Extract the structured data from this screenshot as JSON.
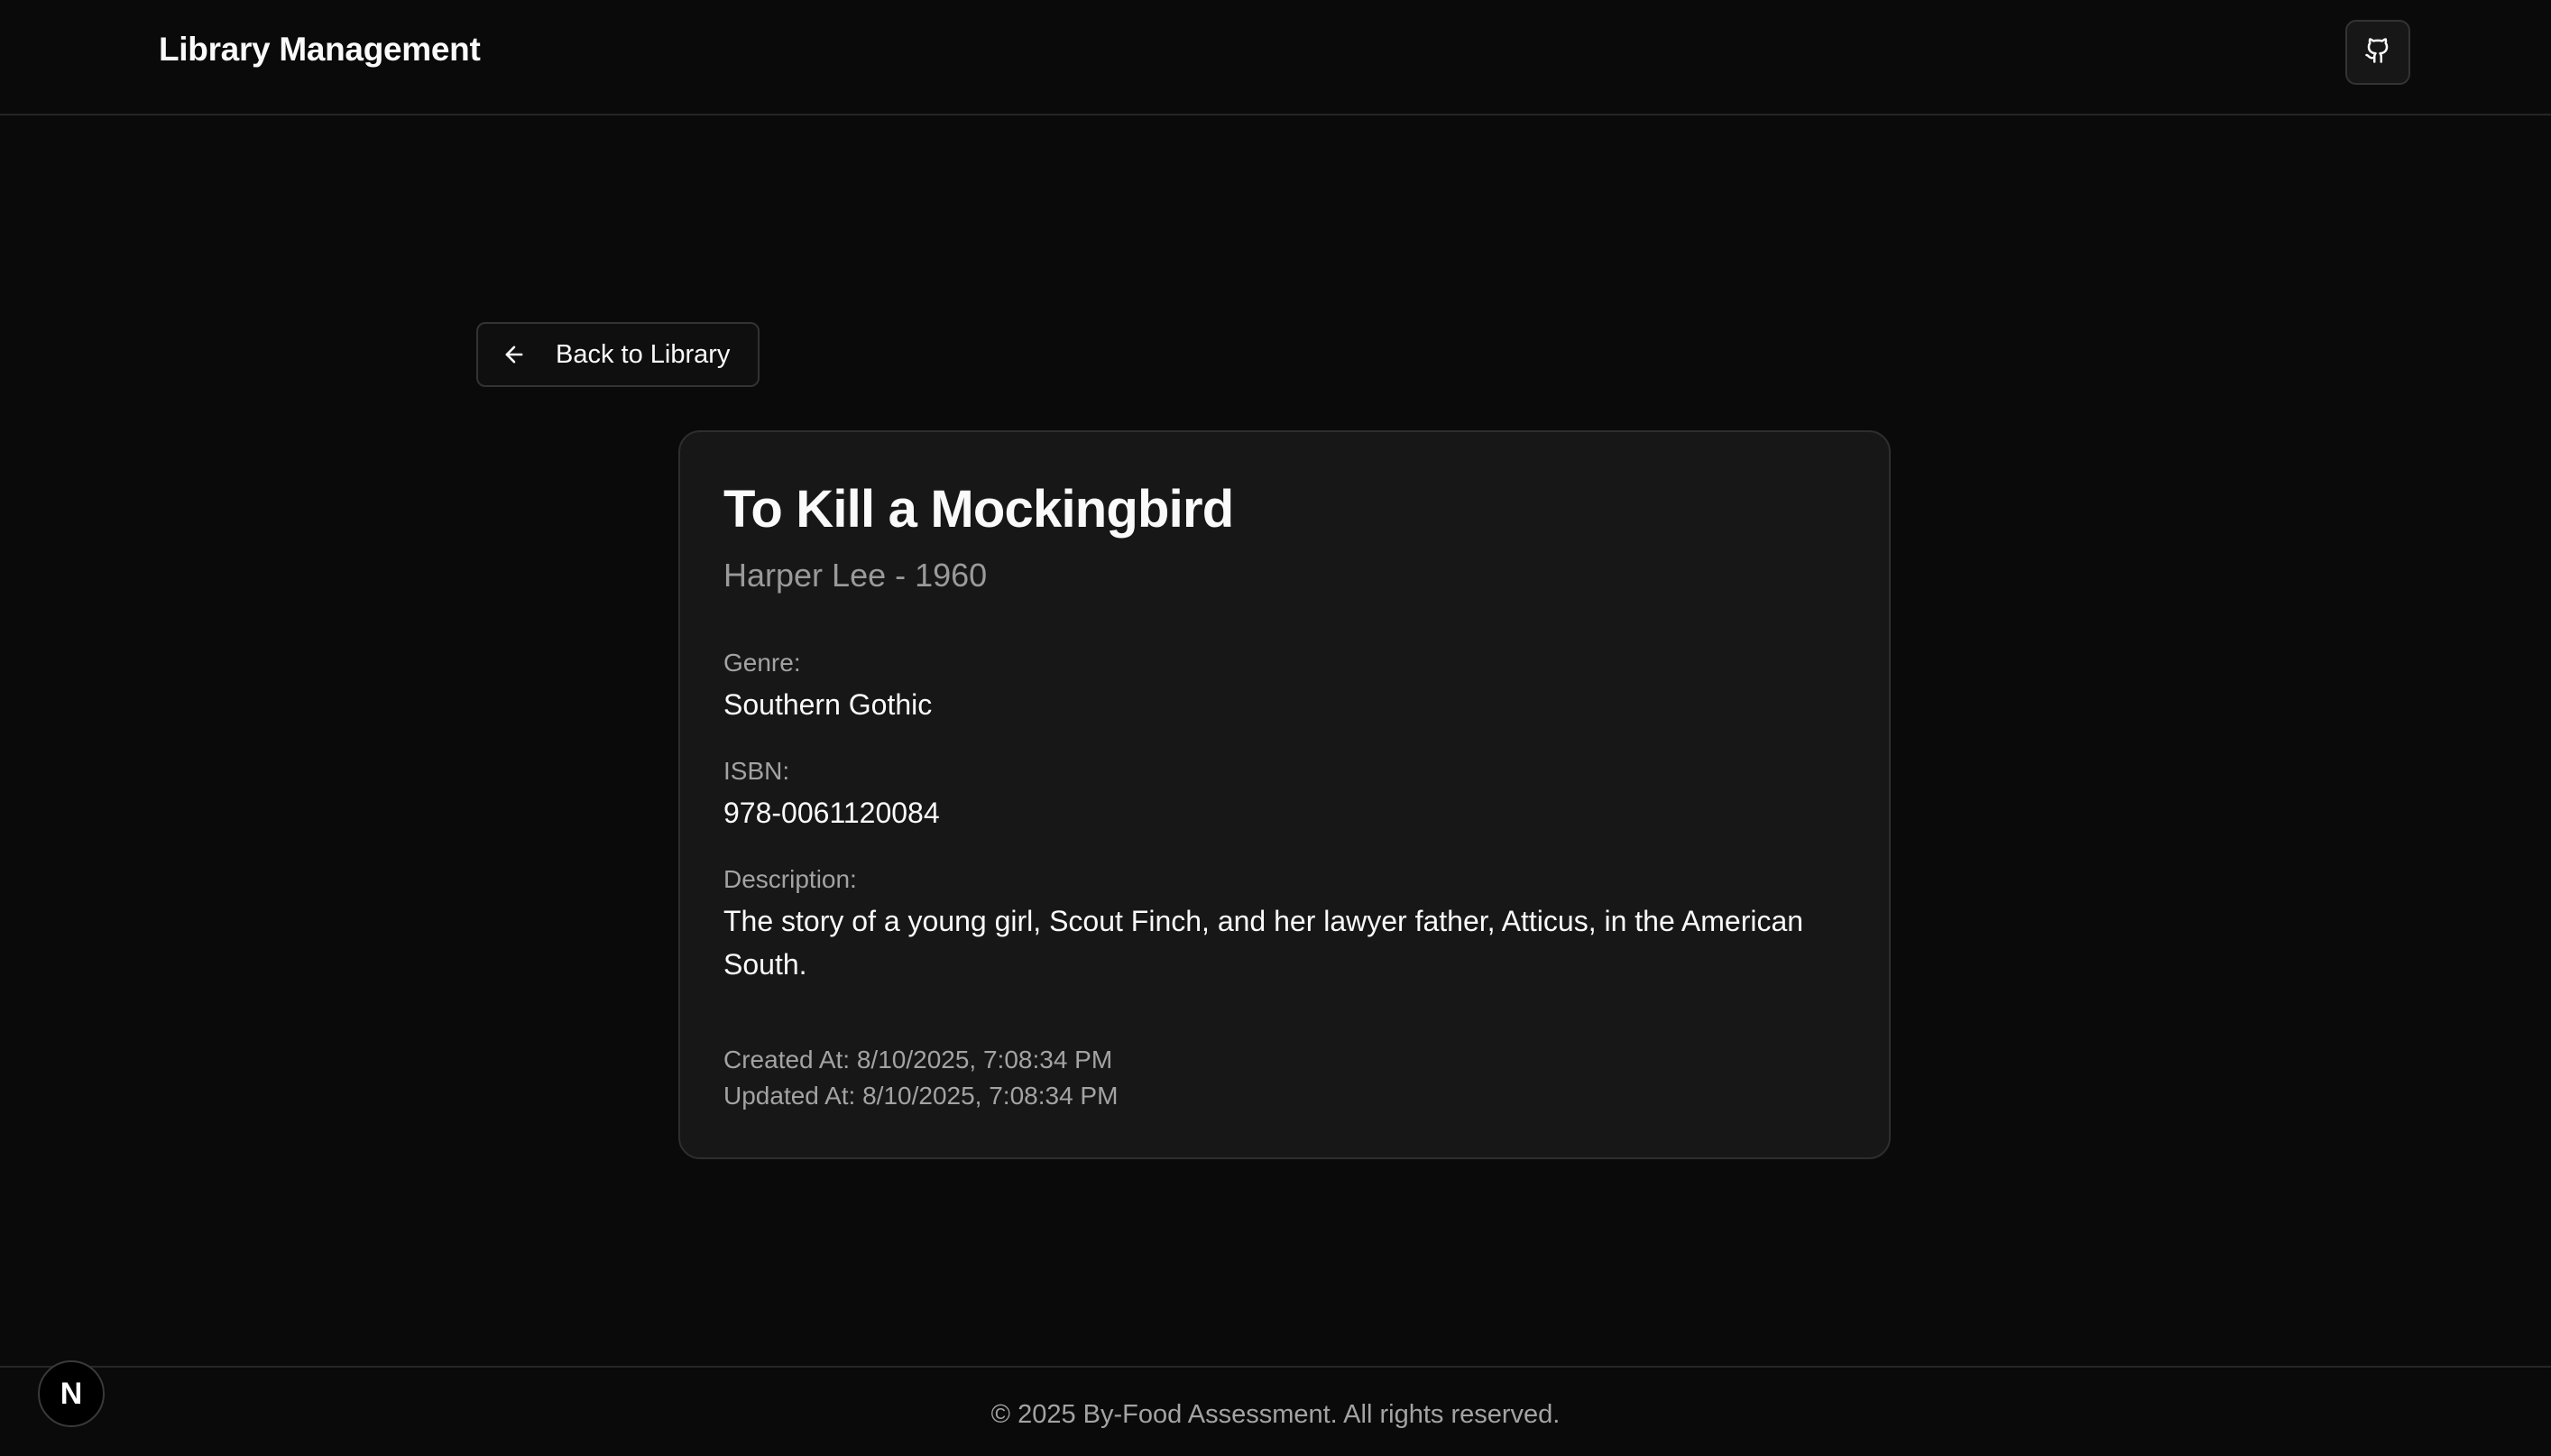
{
  "header": {
    "brand": "Library Management",
    "github_icon": "github-icon"
  },
  "back_button": {
    "label": "Back to Library",
    "icon": "arrow-left-icon"
  },
  "book": {
    "title": "To Kill a Mockingbird",
    "subtitle": "Harper Lee - 1960",
    "genre_label": "Genre:",
    "genre": "Southern Gothic",
    "isbn_label": "ISBN:",
    "isbn": "978-0061120084",
    "description_label": "Description:",
    "description": "The story of a young girl, Scout Finch, and her lawyer father, Atticus, in the American South.",
    "created_at": "Created At: 8/10/2025, 7:08:34 PM",
    "updated_at": "Updated At: 8/10/2025, 7:08:34 PM"
  },
  "footer": {
    "copyright": "© 2025 By-Food Assessment. All rights reserved."
  },
  "dev_badge": {
    "letter": "N",
    "icon": "nextjs-icon"
  },
  "colors": {
    "background": "#0a0a0a",
    "card": "#171717",
    "border": "#2e2e2e",
    "text": "#fafafa",
    "muted": "#a3a3a3"
  }
}
